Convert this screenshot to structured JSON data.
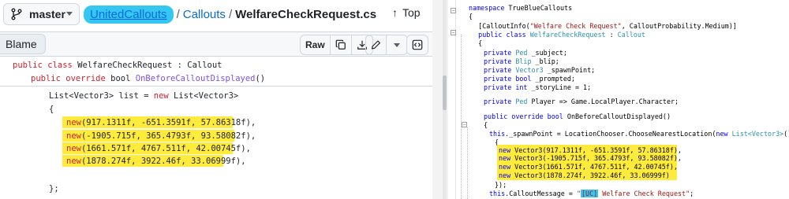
{
  "github": {
    "branch": "master",
    "breadcrumb": {
      "repo": "UnitedCallouts",
      "separator": "/",
      "folder": "Callouts",
      "file": "WelfareCheckRequest.cs"
    },
    "top_label": "Top",
    "blame_label": "Blame",
    "toolbar": {
      "raw_label": "Raw"
    },
    "code": {
      "line1": {
        "kw": "public class",
        "text": " WelfareCheckRequest : Callout"
      },
      "line2": {
        "kw": "public override",
        "text1": " bool ",
        "fn": "OnBeforeCalloutDisplayed",
        "text2": "()"
      },
      "line3": {
        "text1": "List<Vector3> list = ",
        "kw": "new",
        "text2": " List<Vector3>"
      },
      "line4": "{",
      "vectors": [
        {
          "kw": "new",
          "args": "(917.1311f, -651.3591f, 57.86318f),"
        },
        {
          "kw": "new",
          "args": "(-1905.715f, 365.4793f, 93.58082f),"
        },
        {
          "kw": "new",
          "args": "(1661.571f, 4767.511f, 42.00745f),"
        },
        {
          "kw": "new",
          "args": "(1878.274f, 3922.46f, 33.06999f),"
        }
      ],
      "closing": "};"
    }
  },
  "vs": {
    "lines": {
      "l0": "",
      "l1_kw": "namespace",
      "l1_text": " TrueBlueCallouts",
      "l2": "{",
      "l3_a": "    [CalloutInfo(",
      "l3_str": "\"Welfare Check Request\"",
      "l3_b": ", CalloutProbability.Medium)]",
      "l4_kw": "    public class",
      "l4_ty": " WelfareCheckRequest",
      "l4_b": " : ",
      "l4_ty2": "Callout",
      "l5": "    {",
      "fields": [
        {
          "kw": "private",
          "ty": " Ped",
          "rest": " _subject;"
        },
        {
          "kw": "private",
          "ty": " Blip",
          "rest": " _blip;"
        },
        {
          "kw": "private",
          "ty": " Vector3",
          "rest": " _spawnPoint;"
        },
        {
          "kw": "private",
          "ty": " bool",
          "rest": " _prompted;"
        },
        {
          "kw": "private",
          "ty": " int",
          "rest": " _storyLine = 1;"
        }
      ],
      "player_kw": "private",
      "player_ty": " Ped",
      "player_rest": " Player => Game.LocalPlayer.Character;",
      "method_kw": "public override",
      "method_ty": " bool",
      "method_rest": " OnBeforeCalloutDisplayed()",
      "brace_open": "{",
      "spawn_kw": "this",
      "spawn_rest1": "._spawnPoint = LocationChooser.ChooseNearestLocation(",
      "spawn_new": "new",
      "spawn_ty": " List<Vector3>",
      "spawn_rest2": "()",
      "inner_brace": "{",
      "vectors": [
        {
          "kw": "new",
          "rest": " Vector3(917.1311f, -651.3591f, 57.86318f),"
        },
        {
          "kw": "new",
          "rest": " Vector3(-1905.715f, 365.4793f, 93.58082f),"
        },
        {
          "kw": "new",
          "rest": " Vector3(1661.571f, 4767.511f, 42.00745f),"
        },
        {
          "kw": "new",
          "rest": " Vector3(1878.274f, 3922.46f, 33.06999f)"
        }
      ],
      "close_list": "});",
      "msg_kw": "this",
      "msg_rest": ".CalloutMessage = ",
      "msg_str_a": "\"",
      "msg_uc": "[UC]",
      "msg_str_b": " Welfare Check Request\"",
      "msg_end": ";"
    }
  }
}
